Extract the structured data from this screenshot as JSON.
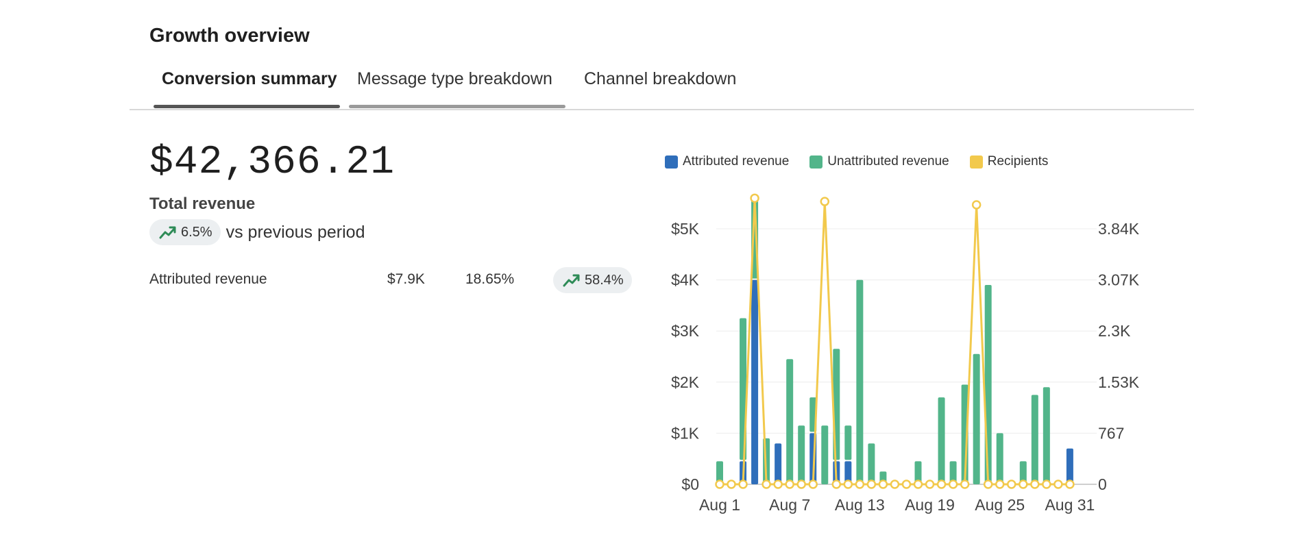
{
  "card": {
    "title": "Growth overview"
  },
  "tabs": [
    {
      "label": "Conversion summary",
      "active": true
    },
    {
      "label": "Message type breakdown",
      "active": false
    },
    {
      "label": "Channel breakdown",
      "active": false
    }
  ],
  "summary": {
    "total_value": "$42,366.21",
    "total_label": "Total revenue",
    "change_pct": "6.5%",
    "change_suffix": "vs previous period",
    "trend_icon": "trending-up-icon"
  },
  "attributed_row": {
    "label": "Attributed revenue",
    "value": "$7.9K",
    "share": "18.65%",
    "change_pct": "58.4%"
  },
  "colors": {
    "attributed": "#2f6eba",
    "unattributed": "#52b58a",
    "recipients": "#f2c94c",
    "trend_up": "#2e8b57"
  },
  "chart_data": {
    "type": "bar",
    "stacked": true,
    "title": "",
    "legend_position": "top",
    "x_tick_labels": [
      "Aug 1",
      "Aug 7",
      "Aug 13",
      "Aug 19",
      "Aug 25",
      "Aug 31"
    ],
    "y_left": {
      "min": 0,
      "max": 5000,
      "ticks": [
        "$0",
        "$1K",
        "$2K",
        "$3K",
        "$4K",
        "$5K"
      ]
    },
    "y_right": {
      "min": 0,
      "max": 3840,
      "ticks": [
        "0",
        "767",
        "1.53K",
        "2.3K",
        "3.07K",
        "3.84K"
      ]
    },
    "grid": true,
    "categories": [
      "Aug 1",
      "Aug 2",
      "Aug 3",
      "Aug 4",
      "Aug 5",
      "Aug 6",
      "Aug 7",
      "Aug 8",
      "Aug 9",
      "Aug 10",
      "Aug 11",
      "Aug 12",
      "Aug 13",
      "Aug 14",
      "Aug 15",
      "Aug 16",
      "Aug 17",
      "Aug 18",
      "Aug 19",
      "Aug 20",
      "Aug 21",
      "Aug 22",
      "Aug 23",
      "Aug 24",
      "Aug 25",
      "Aug 26",
      "Aug 27",
      "Aug 28",
      "Aug 29",
      "Aug 30",
      "Aug 31"
    ],
    "series": [
      {
        "name": "Attributed revenue",
        "axis": "left",
        "kind": "bar",
        "values": [
          0,
          0,
          450,
          4000,
          0,
          800,
          0,
          0,
          1000,
          0,
          450,
          450,
          0,
          0,
          0,
          0,
          0,
          0,
          0,
          0,
          0,
          0,
          0,
          0,
          0,
          0,
          0,
          0,
          0,
          0,
          700
        ]
      },
      {
        "name": "Unattributed revenue",
        "axis": "left",
        "kind": "bar",
        "values": [
          450,
          0,
          2800,
          1650,
          900,
          0,
          2450,
          1150,
          700,
          1150,
          2200,
          700,
          4000,
          800,
          250,
          0,
          0,
          450,
          0,
          1700,
          450,
          1950,
          2550,
          3900,
          1000,
          0,
          450,
          1750,
          1900,
          0,
          0
        ]
      },
      {
        "name": "Recipients",
        "axis": "right",
        "kind": "line",
        "values": [
          0,
          0,
          0,
          4300,
          0,
          0,
          0,
          0,
          0,
          4250,
          0,
          0,
          0,
          0,
          0,
          0,
          0,
          0,
          0,
          0,
          0,
          0,
          4200,
          0,
          0,
          0,
          0,
          0,
          0,
          0,
          0
        ]
      }
    ]
  }
}
